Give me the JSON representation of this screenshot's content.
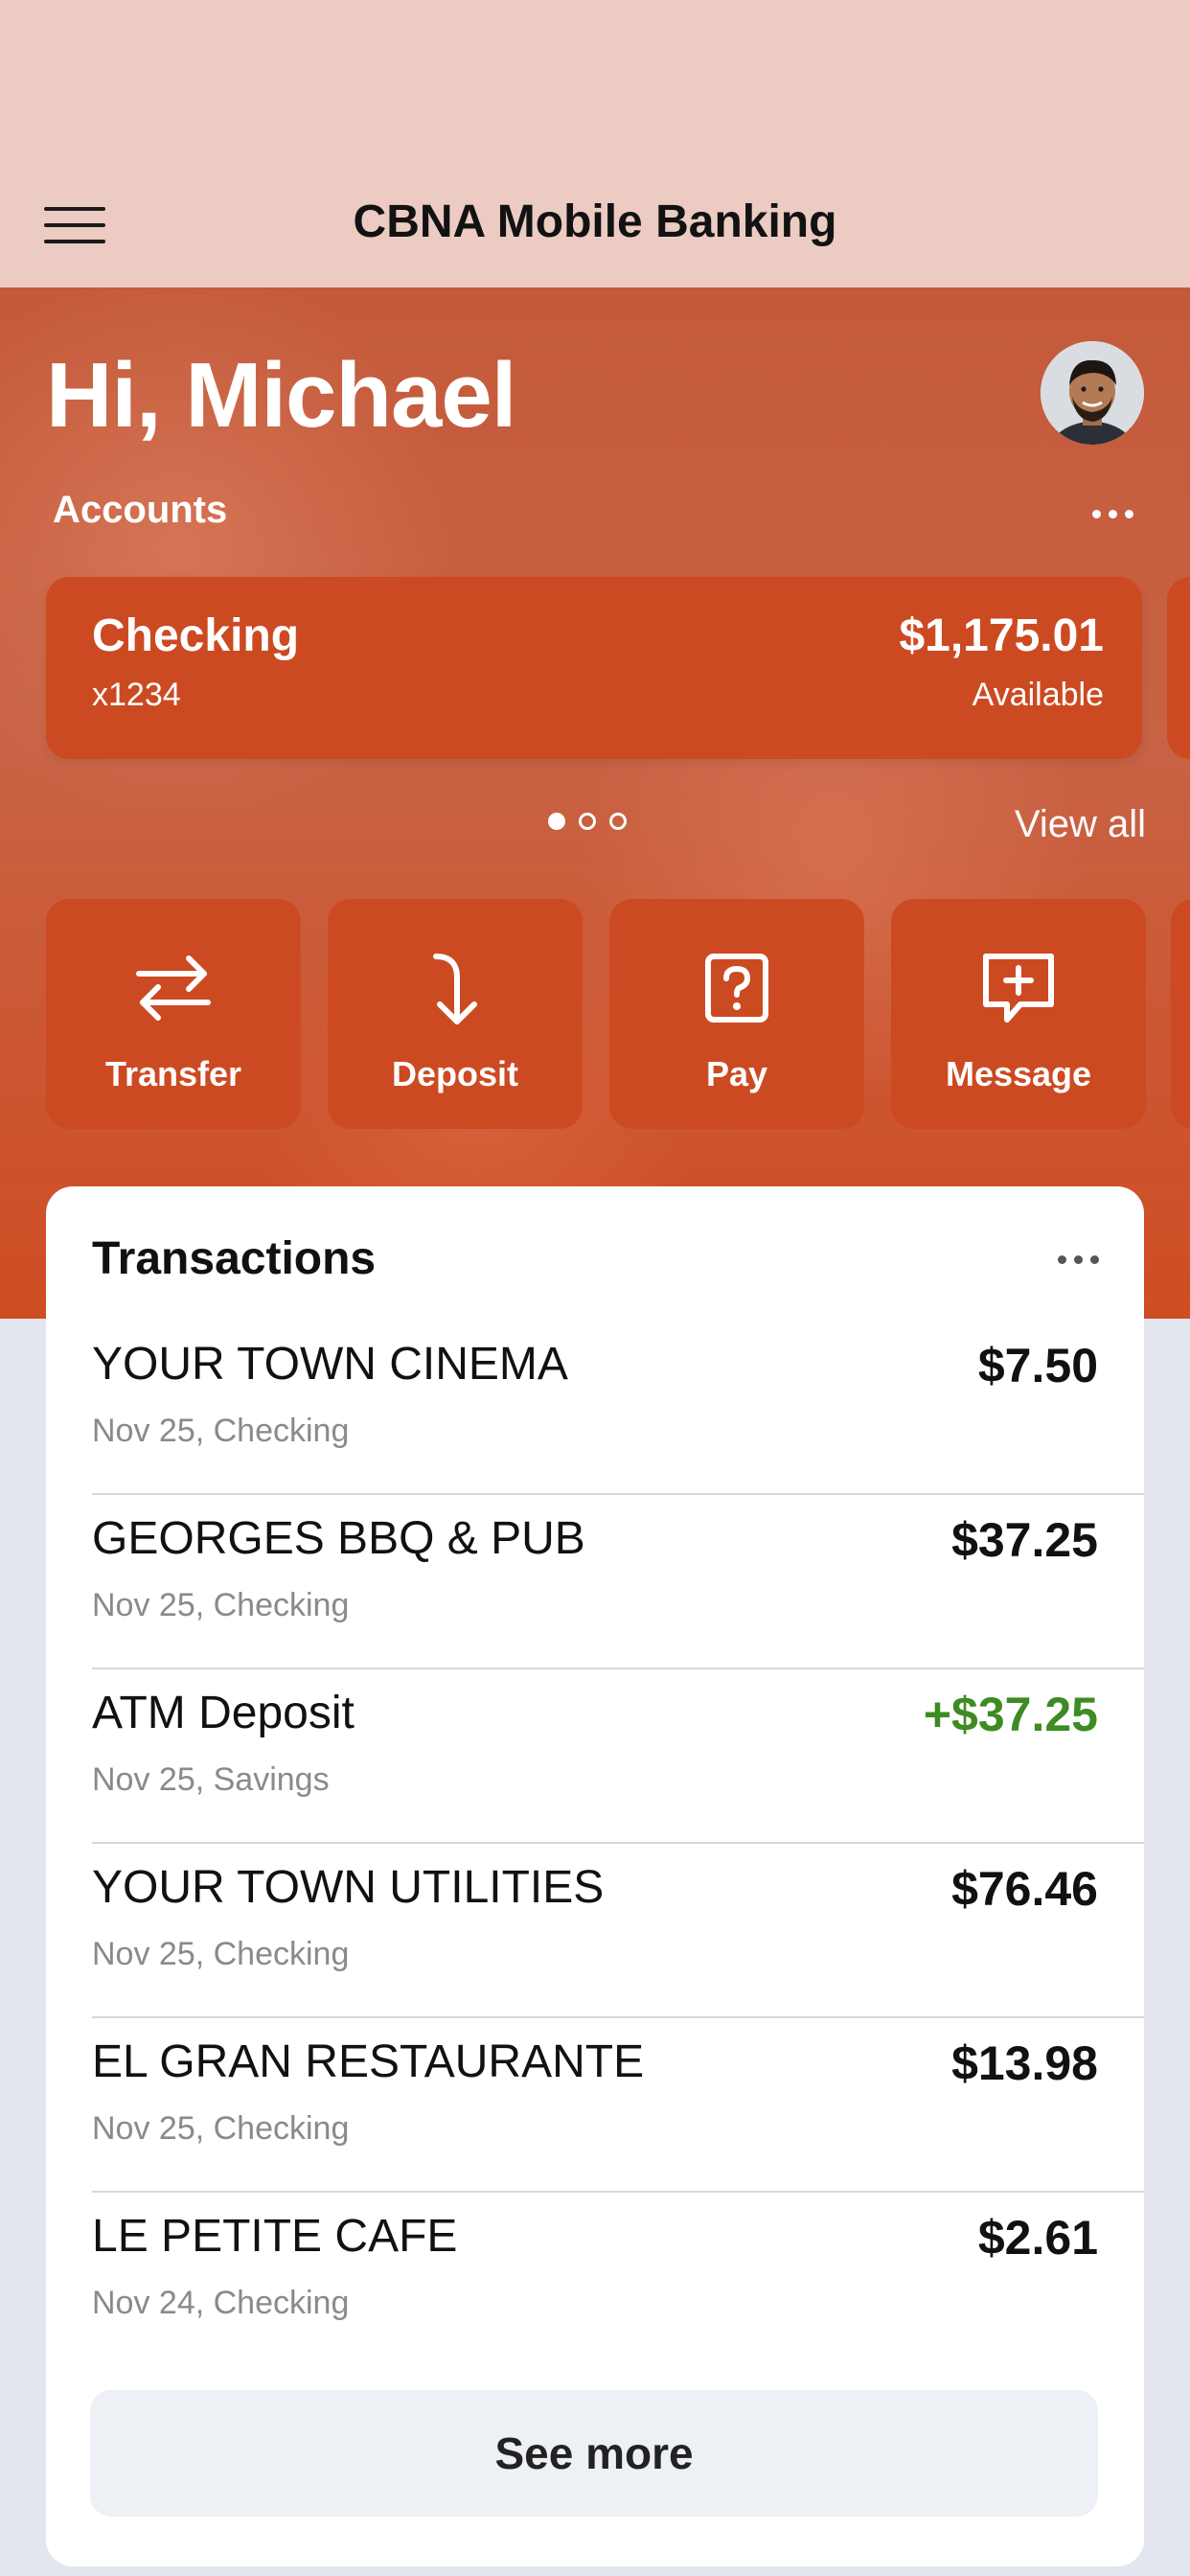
{
  "header": {
    "title": "CBNA Mobile Banking",
    "menu_icon": "hamburger-menu-icon"
  },
  "hero": {
    "greeting": "Hi, Michael",
    "accounts_label": "Accounts",
    "accounts_more_icon": "more-horizontal-icon",
    "account": {
      "name": "Checking",
      "number": "x1234",
      "balance": "$1,175.01",
      "balance_caption": "Available"
    },
    "pager": {
      "pages": 3,
      "current": 1
    },
    "view_all": "View all"
  },
  "actions": [
    {
      "label": "Transfer",
      "icon": "transfer-arrows-icon"
    },
    {
      "label": "Deposit",
      "icon": "deposit-arrow-icon"
    },
    {
      "label": "Pay",
      "icon": "pay-question-icon"
    },
    {
      "label": "Message",
      "icon": "message-plus-icon"
    }
  ],
  "transactions": {
    "title": "Transactions",
    "more_icon": "more-horizontal-icon",
    "items": [
      {
        "merchant": "YOUR TOWN CINEMA",
        "meta": "Nov 25, Checking",
        "amount": "$7.50"
      },
      {
        "merchant": "GEORGES BBQ & PUB",
        "meta": "Nov 25, Checking",
        "amount": "$37.25"
      },
      {
        "merchant": "ATM Deposit",
        "meta": "Nov 25, Savings",
        "amount": "+$37.25"
      },
      {
        "merchant": "YOUR TOWN UTILITIES",
        "meta": "Nov 25, Checking",
        "amount": "$76.46"
      },
      {
        "merchant": "EL GRAN RESTAURANTE",
        "meta": "Nov 25, Checking",
        "amount": "$13.98"
      },
      {
        "merchant": "LE PETITE CAFE",
        "meta": "Nov 24, Checking",
        "amount": "$2.61"
      }
    ],
    "see_more": "See more"
  },
  "colors": {
    "accent": "#cc4a22",
    "header_bg": "#ecccc2",
    "credit": "#3d8b22"
  }
}
